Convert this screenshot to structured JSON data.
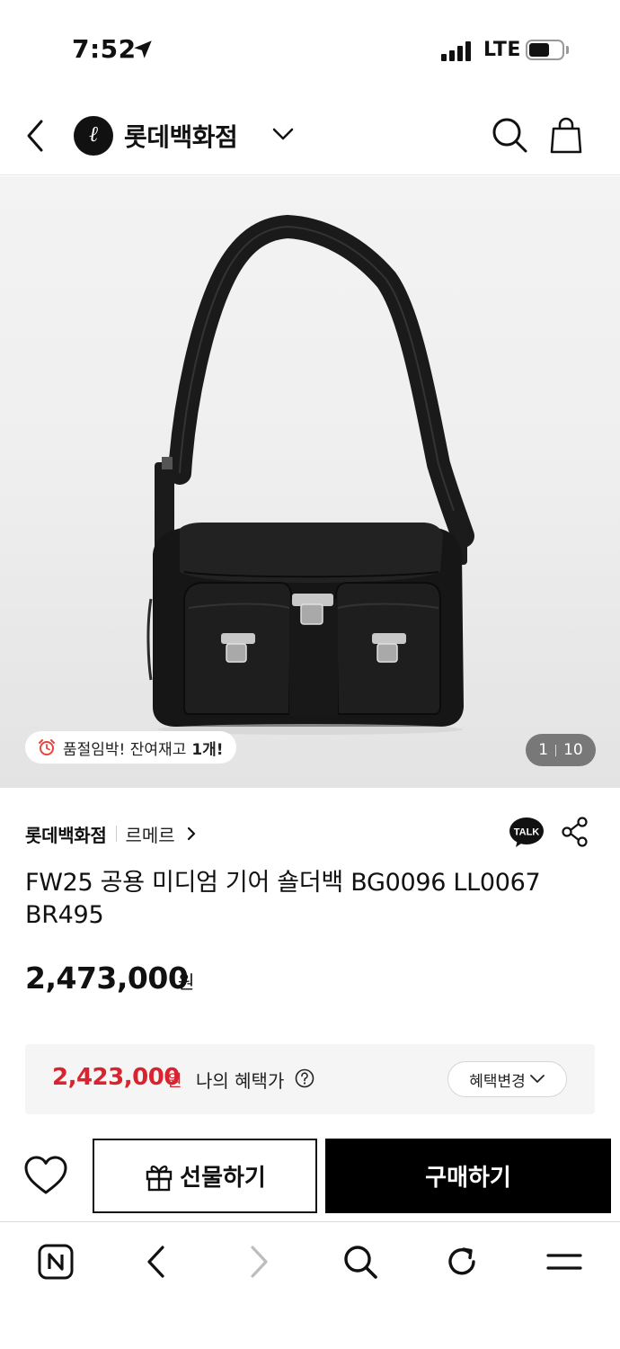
{
  "status_bar": {
    "time": "7:52",
    "network": "LTE",
    "icons": [
      "location-arrow-icon",
      "signal-icon",
      "battery-icon"
    ]
  },
  "header": {
    "store_name": "롯데백화점",
    "logo_letter": "ℓ",
    "icons": [
      "back-icon",
      "chevron-down-icon",
      "search-icon",
      "shopping-bag-icon"
    ]
  },
  "hero": {
    "image_index": "1",
    "image_total": "10",
    "stock_text": "품절임박! 잔여재고",
    "stock_count": "1개!"
  },
  "product": {
    "store_name": "롯데백화점",
    "brand": "르메르",
    "title": "FW25 공용 미디엄 기어 숄더백 BG0096 LL0067 BR495",
    "price": "2,473,000",
    "price_unit": "원"
  },
  "benefit": {
    "price": "2,423,000",
    "price_unit": "원",
    "label": "나의 혜택가",
    "change_label": "혜택변경"
  },
  "cta": {
    "gift_label": "선물하기",
    "buy_label": "구매하기"
  },
  "browser_bar": {
    "items": [
      "naver-home-icon",
      "back-icon",
      "forward-icon",
      "search-icon",
      "refresh-icon",
      "menu-icon"
    ]
  },
  "colors": {
    "accent_red": "#d9232e",
    "primary_black": "#000000",
    "benefit_bg": "#f5f5f5",
    "badge_clock_red": "#e8453c"
  }
}
